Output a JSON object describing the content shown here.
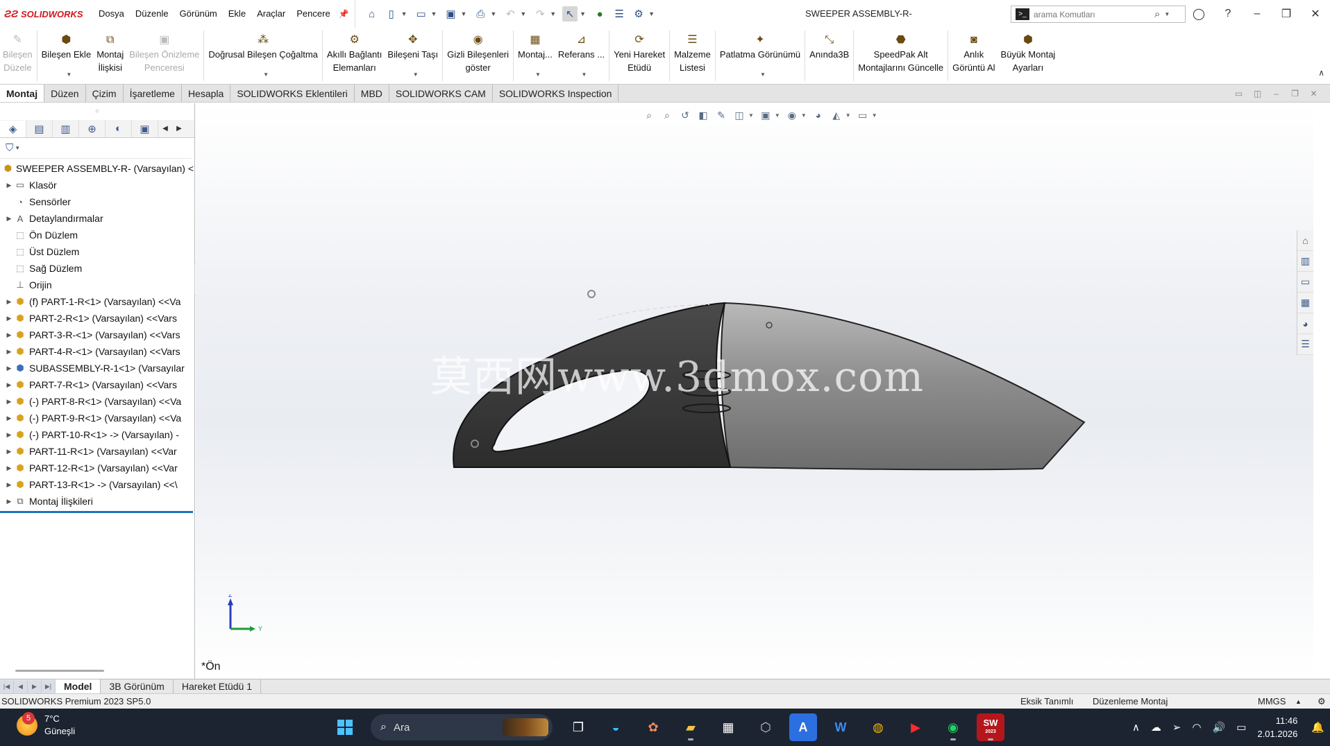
{
  "app": {
    "brand": "SOLIDWORKS",
    "window_title": "SWEEPER ASSEMBLY-R-",
    "menu": [
      "Dosya",
      "Düzenle",
      "Görünüm",
      "Ekle",
      "Araçlar",
      "Pencere"
    ],
    "search_placeholder": "arama Komutları"
  },
  "ribbon": [
    {
      "line1": "Bileşen",
      "line2": "Düzele",
      "disabled": true,
      "icon": "edit-component-icon"
    },
    {
      "line1": "Bileşen Ekle",
      "line2": "",
      "disabled": false,
      "icon": "insert-component-icon",
      "dropdown": true
    },
    {
      "line1": "Montaj",
      "line2": "İlişkisi",
      "disabled": false,
      "icon": "mate-icon"
    },
    {
      "line1": "Bileşen Önizleme",
      "line2": "Penceresi",
      "disabled": true,
      "icon": "preview-window-icon"
    },
    {
      "line1": "Doğrusal Bileşen Çoğaltma",
      "line2": "",
      "disabled": false,
      "icon": "linear-pattern-icon",
      "dropdown": true
    },
    {
      "line1": "Akıllı Bağlantı",
      "line2": "Elemanları",
      "disabled": false,
      "icon": "smart-fasteners-icon"
    },
    {
      "line1": "Bileşeni Taşı",
      "line2": "",
      "disabled": false,
      "icon": "move-component-icon",
      "dropdown": true
    },
    {
      "line1": "Gizli Bileşenleri",
      "line2": "göster",
      "disabled": false,
      "icon": "show-hidden-icon"
    },
    {
      "line1": "Montaj...",
      "line2": "",
      "disabled": false,
      "icon": "assembly-features-icon",
      "dropdown": true
    },
    {
      "line1": "Referans ...",
      "line2": "",
      "disabled": false,
      "icon": "reference-geometry-icon",
      "dropdown": true
    },
    {
      "line1": "Yeni Hareket",
      "line2": "Etüdü",
      "disabled": false,
      "icon": "motion-study-icon"
    },
    {
      "line1": "Malzeme",
      "line2": "Listesi",
      "disabled": false,
      "icon": "bom-icon"
    },
    {
      "line1": "Patlatma Görünümü",
      "line2": "",
      "disabled": false,
      "icon": "exploded-view-icon",
      "dropdown": true
    },
    {
      "line1": "Anında3B",
      "line2": "",
      "disabled": false,
      "icon": "instant3d-icon"
    },
    {
      "line1": "SpeedPak Alt",
      "line2": "Montajlarını Güncelle",
      "disabled": false,
      "icon": "speedpak-icon"
    },
    {
      "line1": "Anlık",
      "line2": "Görüntü Al",
      "disabled": false,
      "icon": "snapshot-icon"
    },
    {
      "line1": "Büyük Montaj",
      "line2": "Ayarları",
      "disabled": false,
      "icon": "large-assembly-icon"
    }
  ],
  "command_tabs": [
    "Montaj",
    "Düzen",
    "Çizim",
    "İşaretleme",
    "Hesapla",
    "SOLIDWORKS Eklentileri",
    "MBD",
    "SOLIDWORKS CAM",
    "SOLIDWORKS Inspection"
  ],
  "tree": {
    "root": "SWEEPER ASSEMBLY-R- (Varsayılan) <",
    "items": [
      {
        "label": "Klasör",
        "icon": "folder-icon",
        "expand": true
      },
      {
        "label": "Sensörler",
        "icon": "sensor-icon",
        "expand": false
      },
      {
        "label": "Detaylandırmalar",
        "icon": "annotations-icon",
        "expand": true
      },
      {
        "label": "Ön Düzlem",
        "icon": "plane-icon",
        "expand": false
      },
      {
        "label": "Üst Düzlem",
        "icon": "plane-icon",
        "expand": false
      },
      {
        "label": "Sağ Düzlem",
        "icon": "plane-icon",
        "expand": false
      },
      {
        "label": "Orijin",
        "icon": "origin-icon",
        "expand": false
      },
      {
        "label": "(f) PART-1-R<1> (Varsayılan) <<Va",
        "icon": "part-icon",
        "expand": true
      },
      {
        "label": "PART-2-R<1> (Varsayılan) <<Vars",
        "icon": "part-icon",
        "expand": true
      },
      {
        "label": "PART-3-R-<1> (Varsayılan) <<Vars",
        "icon": "part-icon",
        "expand": true
      },
      {
        "label": "PART-4-R-<1> (Varsayılan) <<Vars",
        "icon": "part-icon",
        "expand": true
      },
      {
        "label": "SUBASSEMBLY-R-1<1> (Varsayılar",
        "icon": "subassembly-icon",
        "expand": true
      },
      {
        "label": "PART-7-R<1> (Varsayılan) <<Vars",
        "icon": "part-icon",
        "expand": true
      },
      {
        "label": "(-) PART-8-R<1> (Varsayılan) <<Va",
        "icon": "part-icon",
        "expand": true
      },
      {
        "label": "(-) PART-9-R<1> (Varsayılan) <<Va",
        "icon": "part-icon",
        "expand": true
      },
      {
        "label": "(-) PART-10-R<1> -> (Varsayılan) -",
        "icon": "part-icon",
        "expand": true
      },
      {
        "label": "PART-11-R<1> (Varsayılan) <<Var",
        "icon": "part-icon",
        "expand": true
      },
      {
        "label": "PART-12-R<1> (Varsayılan) <<Var",
        "icon": "part-icon",
        "expand": true
      },
      {
        "label": "PART-13-R<1> -> (Varsayılan) <<\\",
        "icon": "part-icon",
        "expand": true
      },
      {
        "label": "Montaj İlişkileri",
        "icon": "mates-folder-icon",
        "expand": true
      }
    ]
  },
  "viewport": {
    "watermark": "莫西网www.3dmox.com",
    "view_name": "*Ön",
    "axis_z": "Z",
    "axis_y": "Y"
  },
  "bottom_tabs": [
    "Model",
    "3B Görünüm",
    "Hareket Etüdü 1"
  ],
  "status": {
    "product": "SOLIDWORKS Premium 2023 SP5.0",
    "definition": "Eksik Tanımlı",
    "mode": "Düzenleme Montaj",
    "units": "MMGS"
  },
  "taskbar": {
    "weather_badge": "5",
    "temperature": "7°C",
    "weather": "Güneşli",
    "search_label": "Ara",
    "time": "11:46",
    "date": "2.01.2026",
    "sw_badge": "SW",
    "sw_year": "2023"
  },
  "colors": {
    "brand_red": "#d0171e",
    "selection_blue": "#1e73be",
    "taskbar_bg": "#1c2431",
    "model_dark": "#3a3a3a",
    "model_grey": "#8e8e8e"
  }
}
